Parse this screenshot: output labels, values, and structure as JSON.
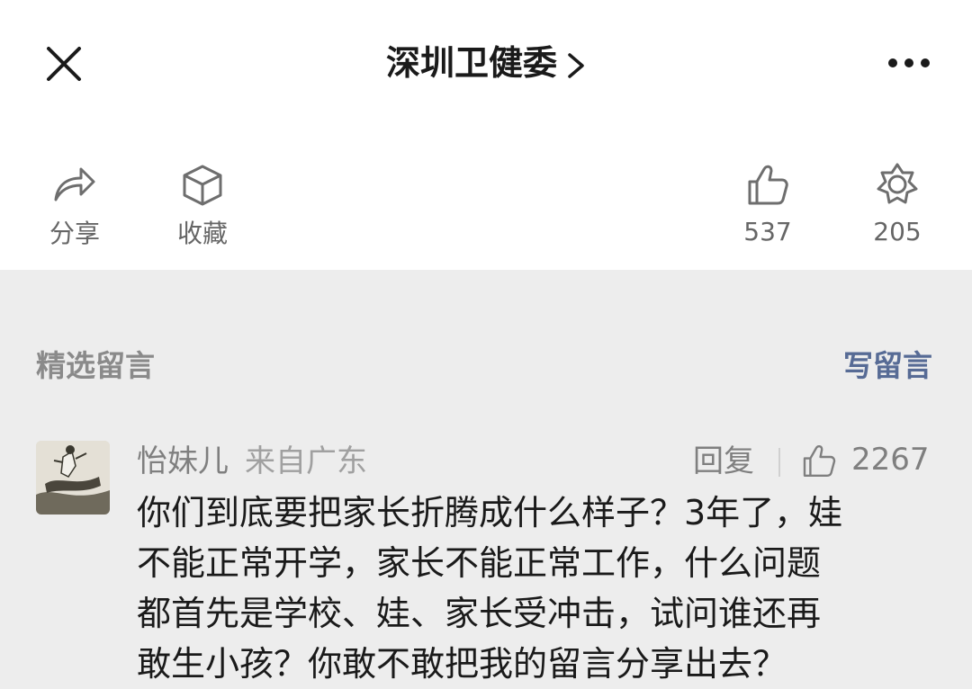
{
  "header": {
    "title": "深圳卫健委",
    "close_icon": "close-icon",
    "chevron_icon": "chevron-right-icon",
    "more_icon": "more-icon"
  },
  "actions": {
    "share": {
      "label": "分享",
      "icon": "share-arrow-icon"
    },
    "favorite": {
      "label": "收藏",
      "icon": "cube-icon"
    },
    "like": {
      "count": "537",
      "icon": "thumbs-up-icon"
    },
    "wow": {
      "count": "205",
      "icon": "star-flower-icon"
    }
  },
  "comments_section": {
    "title": "精选留言",
    "write_label": "写留言",
    "accent_color": "#576b95"
  },
  "comment": {
    "author": "怡妹儿",
    "location": "来自广东",
    "reply_label": "回复",
    "like_count": "2267",
    "lines": [
      "你们到底要把家长折腾成什么样子？3年了，娃",
      "不能正常开学，家长不能正常工作，什么问题",
      "都首先是学校、娃、家长受冲击，试问谁还再",
      "敢生小孩？你敢不敢把我的留言分享出去？"
    ]
  }
}
